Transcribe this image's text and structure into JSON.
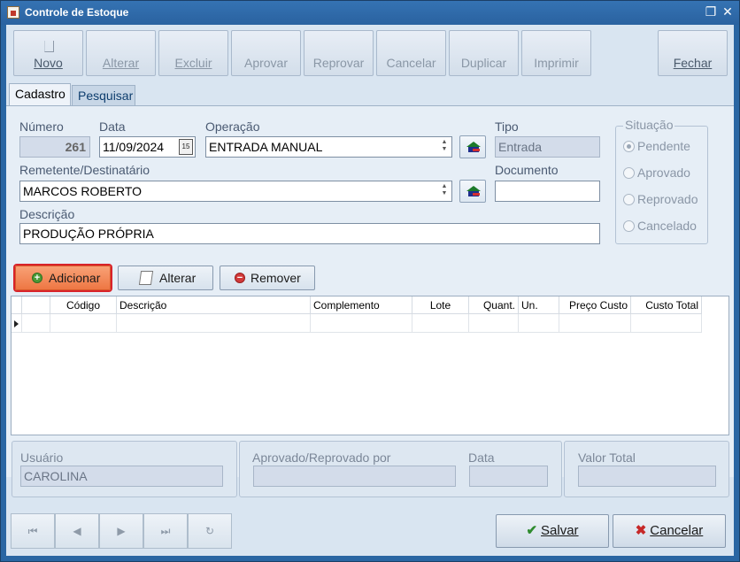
{
  "window": {
    "title": "Controle de Estoque",
    "restore_glyph": "❐",
    "close_glyph": "✕"
  },
  "toolbar": {
    "novo": "Novo",
    "alterar": "Alterar",
    "excluir": "Excluir",
    "aprovar": "Aprovar",
    "reprovar": "Reprovar",
    "cancelar": "Cancelar",
    "duplicar": "Duplicar",
    "imprimir": "Imprimir",
    "fechar": "Fechar"
  },
  "tabs": {
    "cadastro": "Cadastro",
    "pesquisar": "Pesquisar"
  },
  "form": {
    "numero_label": "Número",
    "numero": "261",
    "data_label": "Data",
    "data": "11/09/2024",
    "cal_glyph": "15",
    "operacao_label": "Operação",
    "operacao": "ENTRADA MANUAL",
    "tipo_label": "Tipo",
    "tipo": "Entrada",
    "remetente_label": "Remetente/Destinatário",
    "remetente": "MARCOS ROBERTO",
    "documento_label": "Documento",
    "documento": "",
    "descricao_label": "Descrição",
    "descricao": "PRODUÇÃO PRÓPRIA"
  },
  "situacao": {
    "title": "Situação",
    "options": [
      "Pendente",
      "Aprovado",
      "Reprovado",
      "Cancelado"
    ],
    "selected": "Pendente"
  },
  "items_toolbar": {
    "adicionar": "Adicionar",
    "alterar": "Alterar",
    "remover": "Remover"
  },
  "grid": {
    "columns": [
      "Código",
      "Descrição",
      "Complemento",
      "Lote",
      "Quant.",
      "Un.",
      "Preço Custo",
      "Custo Total"
    ]
  },
  "footer_info": {
    "usuario_label": "Usuário",
    "usuario": "CAROLINA",
    "aprovado_label": "Aprovado/Reprovado por",
    "aprovado": "",
    "data_label": "Data",
    "data": "",
    "valor_label": "Valor Total",
    "valor": ""
  },
  "nav": {
    "first": "⏮",
    "prev": "◀",
    "next": "▶",
    "last": "⏭",
    "refresh": "↻"
  },
  "actions": {
    "salvar": "Salvar",
    "cancelar": "Cancelar"
  }
}
